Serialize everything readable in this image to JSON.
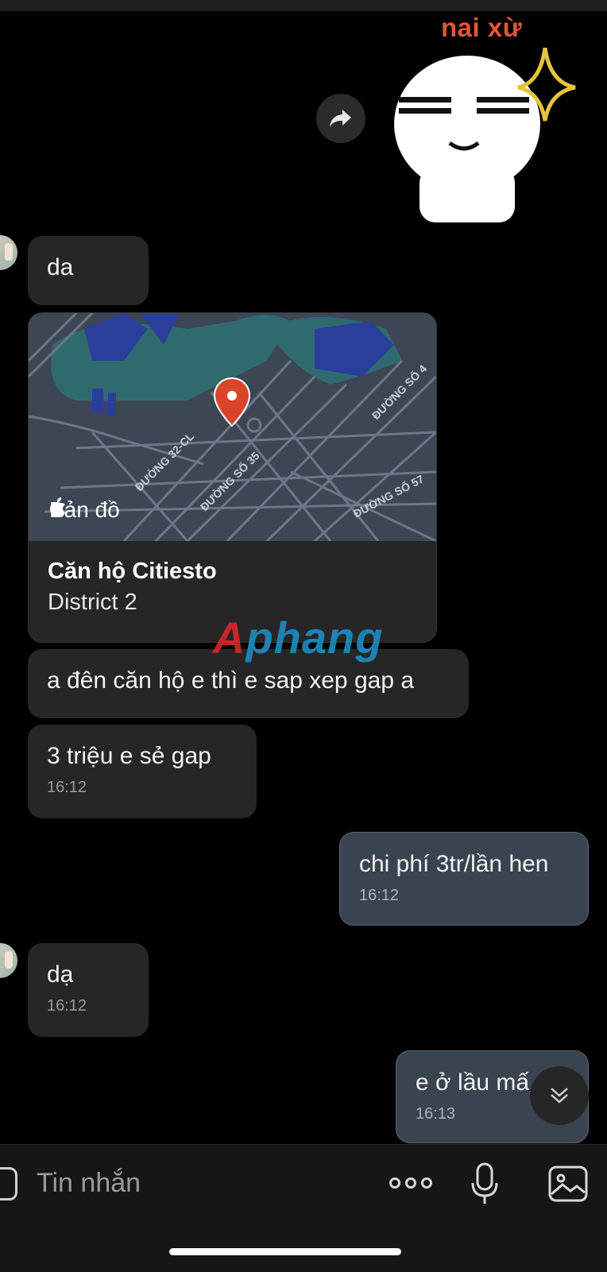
{
  "sticker": {
    "label": "nai xừ",
    "icon": "smug-face-sticker"
  },
  "share_button": {
    "icon": "share-arrow-icon"
  },
  "messages": [
    {
      "direction": "in",
      "text": "da",
      "time": ""
    },
    {
      "direction": "in",
      "text": "a đên căn hộ e thì e sap xep gap a",
      "time": ""
    },
    {
      "direction": "in",
      "text": "3 triệu e sẻ gap",
      "time": "16:12"
    },
    {
      "direction": "out",
      "text": "chi phí 3tr/lần hen",
      "time": "16:12"
    },
    {
      "direction": "in",
      "text": "dạ",
      "time": "16:12"
    },
    {
      "direction": "out",
      "text": "e ở lầu mấ",
      "time": "16:13"
    }
  ],
  "map_card": {
    "brand": "Bản đồ",
    "place_name": "Căn hộ Citiesto",
    "place_subtitle": "District 2",
    "street_labels": [
      "ĐƯỜNG 32-CL",
      "ĐƯỜNG SỐ 35",
      "ĐƯỜNG SỐ 4",
      "ĐƯỜNG SỐ 57"
    ],
    "pin_color": "#d9452b"
  },
  "watermark": {
    "first": "A",
    "rest": "phang"
  },
  "composer": {
    "placeholder": "Tin nhắn",
    "icons": [
      "emoji-icon",
      "more-icon",
      "microphone-icon",
      "image-icon"
    ]
  },
  "colors": {
    "background": "#000000",
    "incoming_bubble": "#262626",
    "outgoing_bubble": "#3a4350",
    "accent_label": "#e2553a"
  }
}
